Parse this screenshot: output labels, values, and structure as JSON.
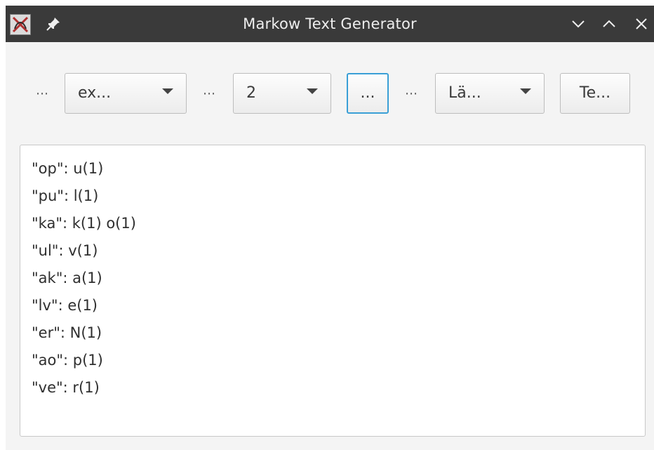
{
  "window": {
    "title": "Markow Text Generator"
  },
  "toolbar": {
    "ellipsis_1": "⋯",
    "combo_1_value": "ex...",
    "ellipsis_2": "⋯",
    "combo_2_value": "2",
    "dots_button_label": "...",
    "ellipsis_3": "⋯",
    "combo_3_value": "Lä...",
    "te_button_label": "Te..."
  },
  "output": {
    "lines": [
      "\"op\": u(1)",
      "\"pu\": l(1)",
      "\"ka\": k(1) o(1)",
      "\"ul\": v(1)",
      "\"ak\": a(1)",
      "\"lv\": e(1)",
      "\"er\": N(1)",
      "\"ao\": p(1)",
      "\"ve\": r(1)"
    ]
  },
  "colors": {
    "titlebar": "#3a3a3a",
    "window_bg": "#f4f4f4",
    "focus_ring": "#3a9fd6"
  },
  "icons": {
    "app": "app-icon",
    "pin": "pin-icon",
    "minimize": "chevron-down-icon",
    "maximize": "chevron-up-icon",
    "close": "close-icon"
  }
}
